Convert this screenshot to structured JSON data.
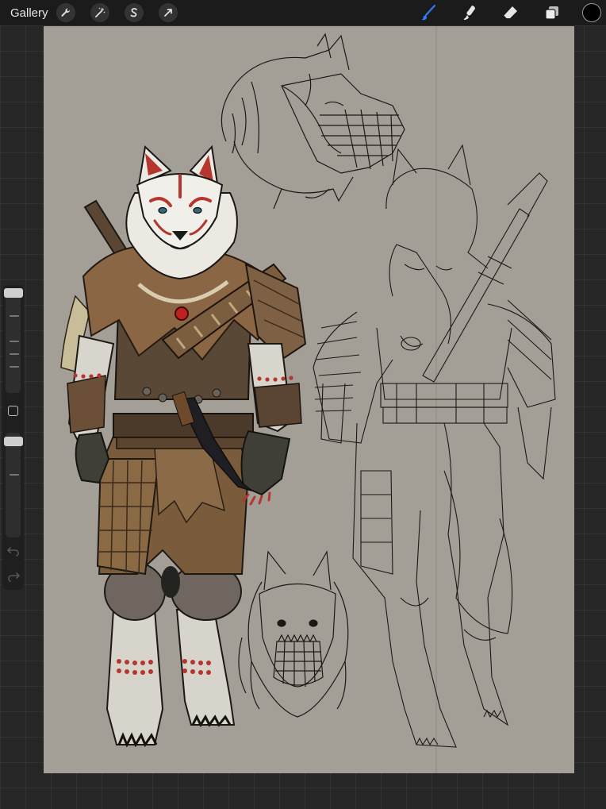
{
  "topbar": {
    "gallery_label": "Gallery",
    "left_tools": [
      "wrench-icon",
      "magic-wand-icon",
      "selection-icon",
      "transform-arrow-icon"
    ],
    "right_tools": [
      "brush-icon",
      "smudge-icon",
      "eraser-icon",
      "layers-icon"
    ],
    "active_tool": "brush",
    "active_tool_color": "#2e7cf6",
    "current_color": "#000000"
  },
  "canvas": {
    "background": "#a39e96",
    "artwork": "wolf-warrior-character-sheet"
  },
  "sidebar": {
    "brush_size_level": 0.1,
    "brush_opacity_level": 0.08
  }
}
